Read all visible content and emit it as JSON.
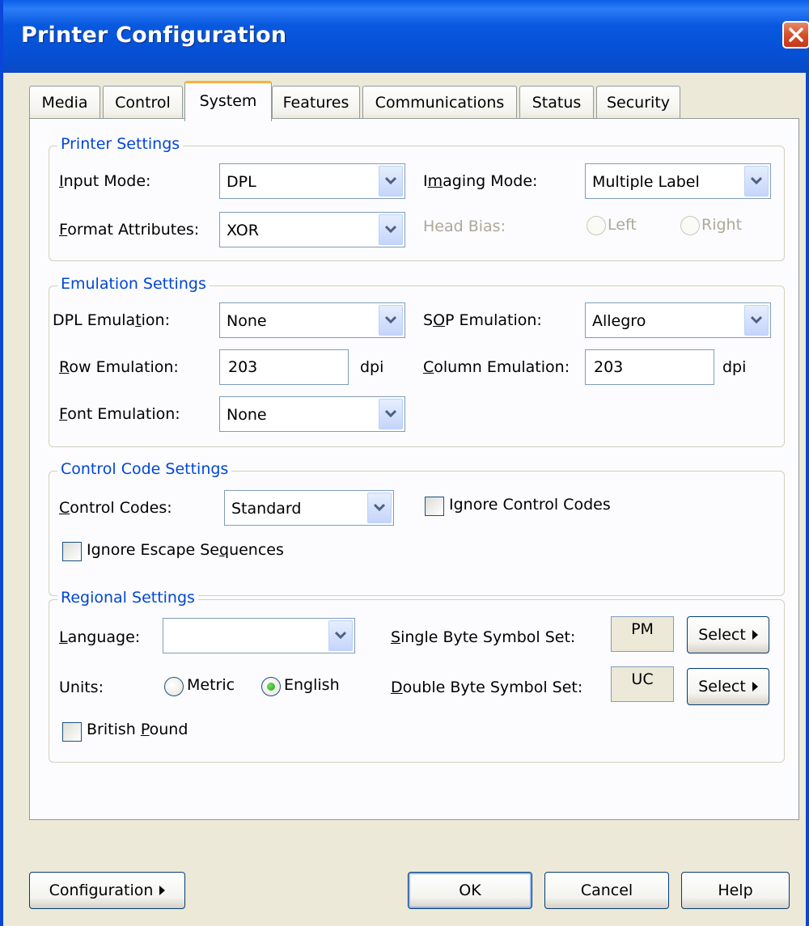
{
  "window": {
    "title": "Printer Configuration"
  },
  "tabs": [
    {
      "label": "Media"
    },
    {
      "label": "Control"
    },
    {
      "label": "System",
      "active": true
    },
    {
      "label": "Features"
    },
    {
      "label": "Communications"
    },
    {
      "label": "Status"
    },
    {
      "label": "Security"
    }
  ],
  "printer_settings": {
    "title": "Printer Settings",
    "input_mode_label": "Input Mode:",
    "input_mode_value": "DPL",
    "format_attributes_label": "Format Attributes:",
    "format_attributes_value": "XOR",
    "imaging_mode_label": "Imaging Mode:",
    "imaging_mode_value": "Multiple Label",
    "head_bias_label": "Head Bias:",
    "head_bias_left": "Left",
    "head_bias_right": "Right"
  },
  "emulation_settings": {
    "title": "Emulation Settings",
    "dpl_emulation_label": "DPL Emulation:",
    "dpl_emulation_value": "None",
    "sop_emulation_label": "SOP Emulation:",
    "sop_emulation_value": "Allegro",
    "row_emulation_label": "Row Emulation:",
    "row_emulation_value": "203",
    "row_unit": "dpi",
    "column_emulation_label": "Column Emulation:",
    "column_emulation_value": "203",
    "column_unit": "dpi",
    "font_emulation_label": "Font Emulation:",
    "font_emulation_value": "None"
  },
  "control_code_settings": {
    "title": "Control Code Settings",
    "control_codes_label": "Control Codes:",
    "control_codes_value": "Standard",
    "ignore_control_codes_label": "Ignore Control Codes",
    "ignore_control_codes_checked": false,
    "ignore_escape_sequences_label": "Ignore Escape Sequences",
    "ignore_escape_sequences_checked": false
  },
  "regional_settings": {
    "title": "Regional Settings",
    "language_label": "Language:",
    "language_value": "",
    "units_label": "Units:",
    "units_metric": "Metric",
    "units_english": "English",
    "units_selected": "English",
    "single_byte_label": "Single Byte Symbol Set:",
    "single_byte_value": "PM",
    "double_byte_label": "Double Byte Symbol Set:",
    "double_byte_value": "UC",
    "select_label": "Select",
    "british_pound_label": "British Pound",
    "british_pound_checked": false
  },
  "footer": {
    "configuration_label": "Configuration",
    "ok_label": "OK",
    "cancel_label": "Cancel",
    "help_label": "Help"
  },
  "colors": {
    "titlebar": "#0a5fe8",
    "group_title": "#0046d5",
    "active_tab_accent": "#f7b33c",
    "close_button": "#d5502a"
  }
}
